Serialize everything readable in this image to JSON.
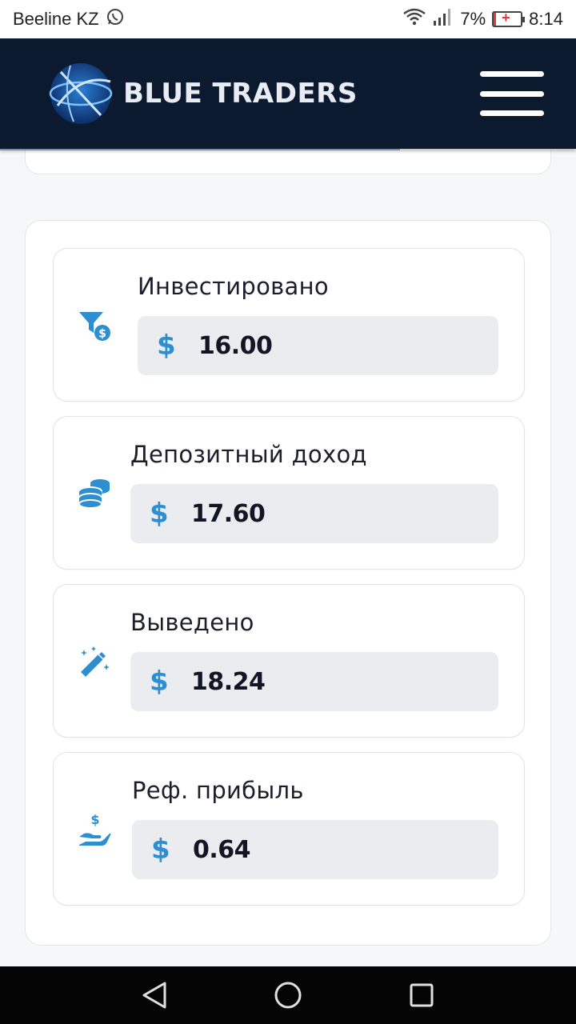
{
  "status_bar": {
    "carrier": "Beeline KZ",
    "battery_percent": "7%",
    "time": "8:14"
  },
  "header": {
    "brand_name": "BLUE TRADERS",
    "menu_icon": "hamburger-menu-icon"
  },
  "colors": {
    "header_bg": "#0c1a30",
    "accent": "#2e8fd0",
    "value_box_bg": "#ebecef"
  },
  "stats": [
    {
      "icon": "funnel-dollar-icon",
      "label": "Инвестировано",
      "currency": "$",
      "value": "16.00"
    },
    {
      "icon": "coins-stack-icon",
      "label": "Депозитный доход",
      "currency": "$",
      "value": "17.60"
    },
    {
      "icon": "magic-wand-icon",
      "label": "Выведено",
      "currency": "$",
      "value": "18.24"
    },
    {
      "icon": "hand-dollar-icon",
      "label": "Реф. прибыль",
      "currency": "$",
      "value": "0.64"
    }
  ],
  "nav": {
    "back_icon": "back-triangle-icon",
    "home_icon": "home-circle-icon",
    "recents_icon": "recents-square-icon"
  }
}
